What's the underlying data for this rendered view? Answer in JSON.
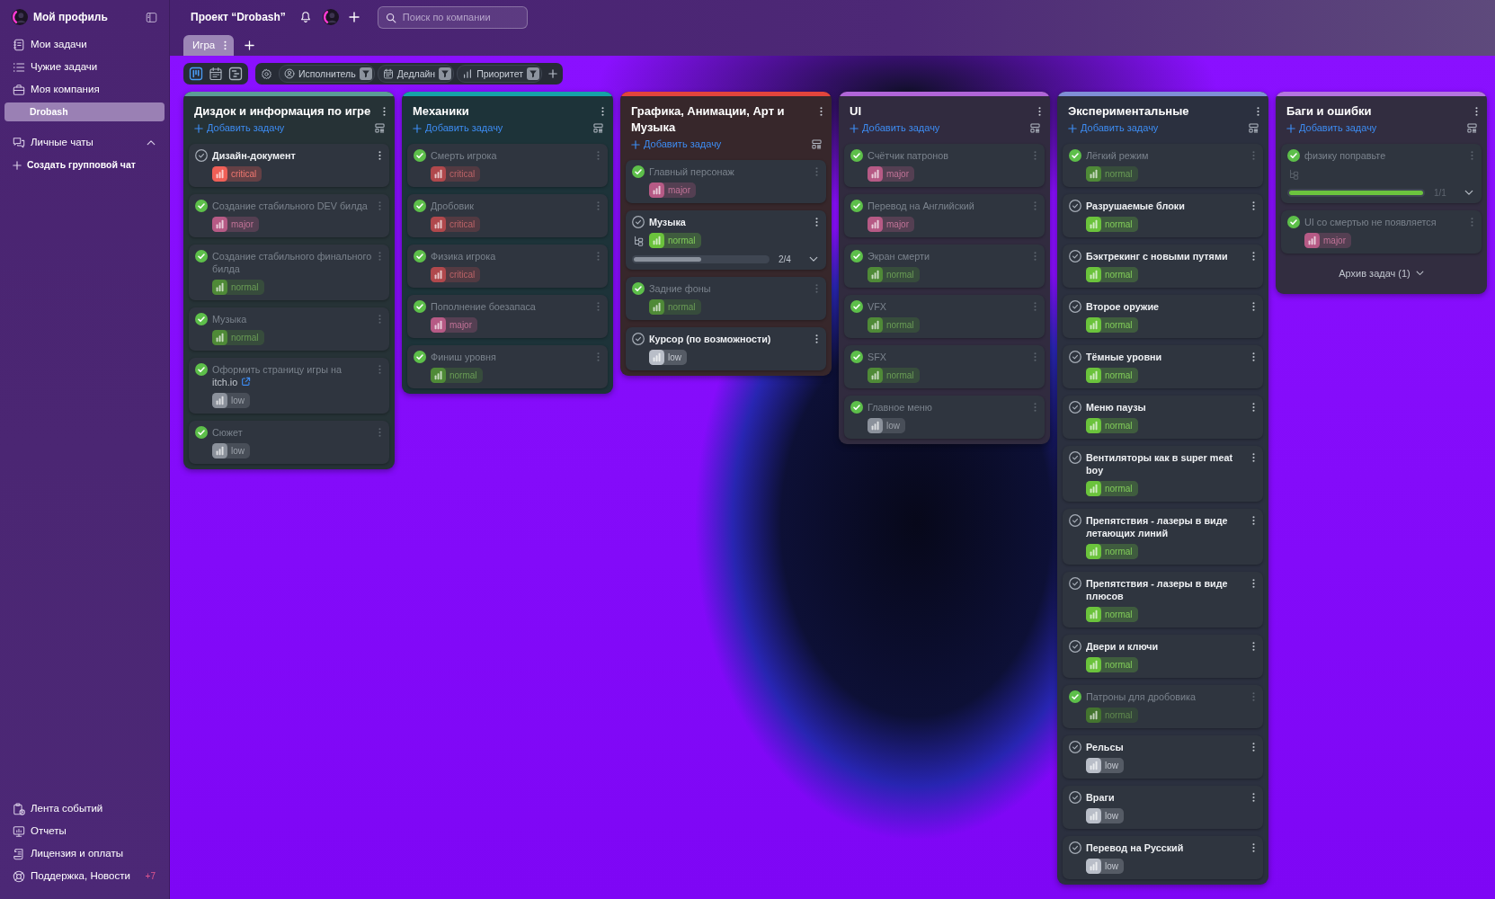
{
  "sidebar": {
    "profile": "Мой профиль",
    "items": [
      {
        "kind": "my-tasks",
        "label": "Мои задачи",
        "selected": false
      },
      {
        "kind": "others-tasks",
        "label": "Чужие задачи",
        "selected": false
      },
      {
        "kind": "company",
        "label": "Моя компания",
        "selected": false
      },
      {
        "kind": "project",
        "label": "Drobash",
        "selected": true
      }
    ],
    "chats": {
      "label": "Личные чаты",
      "expanded": true
    },
    "create_group_chat": "Создать групповой чат",
    "bottom_items": [
      {
        "kind": "feed",
        "label": "Лента событий",
        "selected": false
      },
      {
        "kind": "reports",
        "label": "Отчеты",
        "selected": false
      },
      {
        "kind": "license",
        "label": "Лицензия и оплаты",
        "selected": false
      },
      {
        "kind": "support",
        "label": "Поддержка, Новости",
        "selected": false,
        "count": "+7"
      }
    ]
  },
  "topbar": {
    "project_title": "Проект “Drobash”",
    "search": {
      "placeholder": "Поиск по компании"
    }
  },
  "tabs": [
    {
      "label": "Игра",
      "selected": true
    }
  ],
  "toolbar": {
    "views": [
      {
        "kind": "board",
        "selected": true
      },
      {
        "kind": "calendar",
        "selected": false
      },
      {
        "kind": "gantt",
        "selected": false
      }
    ],
    "filters": [
      {
        "kind": "assignee",
        "label": "Исполнитель"
      },
      {
        "kind": "deadline",
        "label": "Дедлайн"
      },
      {
        "kind": "priority",
        "label": "Приоритет"
      }
    ]
  },
  "columns": [
    {
      "title": "Диздок и информация по игре",
      "color": "#5b9c96",
      "add_task": "Добавить задачу",
      "cards": [
        {
          "title": "Дизайн-документ",
          "done": false,
          "badge": {
            "label": "critical",
            "color": "#ef5f57"
          }
        },
        {
          "title": "Создание стабильного DEV билда",
          "done": true,
          "badge": {
            "label": "major",
            "color": "#b65a85"
          }
        },
        {
          "title": "Создание стабильного финального билда",
          "done": true,
          "badge": {
            "label": "normal",
            "color": "#4f8a37"
          }
        },
        {
          "title": "Музыка",
          "done": true,
          "badge": {
            "label": "normal",
            "color": "#4f8a37"
          }
        },
        {
          "title": "Оформить страницу игры на",
          "link": "itch.io",
          "done": true,
          "badge": {
            "label": "low",
            "color": "#8b919b"
          }
        },
        {
          "title": "Сюжет",
          "done": true,
          "badge": {
            "label": "low",
            "color": "#8b919b"
          }
        }
      ]
    },
    {
      "title": "Механики",
      "color": "#16a2a8",
      "add_task": "Добавить задачу",
      "cards": [
        {
          "title": "Смерть игрока",
          "done": true,
          "badge": {
            "label": "critical",
            "color": "#b0484c"
          }
        },
        {
          "title": "Дробовик",
          "done": true,
          "badge": {
            "label": "critical",
            "color": "#b0484c"
          }
        },
        {
          "title": "Физика игрока",
          "done": true,
          "badge": {
            "label": "critical",
            "color": "#b0484c"
          }
        },
        {
          "title": "Пополнение боезапаса",
          "done": true,
          "badge": {
            "label": "major",
            "color": "#b65a85"
          }
        },
        {
          "title": "Финиш уровня",
          "done": true,
          "badge": {
            "label": "normal",
            "color": "#4f8a37"
          }
        }
      ]
    },
    {
      "title": "Графика, Анимации, Арт и Музыка",
      "color": "#e2453c",
      "add_task": "Добавить задачу",
      "cards": [
        {
          "title": "Главный персонаж",
          "done": true,
          "badge": {
            "label": "major",
            "color": "#b65a85"
          }
        },
        {
          "title": "Музыка",
          "done": false,
          "badge": {
            "label": "normal",
            "color": "#6bc33c"
          },
          "subtasks": {
            "level": 0.5,
            "reading": "2/4"
          }
        },
        {
          "title": "Задние фоны",
          "done": true,
          "badge": {
            "label": "normal",
            "color": "#4f8a37"
          }
        },
        {
          "title": "Курсор (по возможности)",
          "done": false,
          "badge": {
            "label": "low",
            "color": "#b9bec8"
          }
        }
      ]
    },
    {
      "title": "UI",
      "color": "#b065d8",
      "add_task": "Добавить задачу",
      "cards": [
        {
          "title": "Счётчик патронов",
          "done": true,
          "badge": {
            "label": "major",
            "color": "#b65a85"
          }
        },
        {
          "title": "Перевод на Английский",
          "done": true,
          "badge": {
            "label": "major",
            "color": "#b65a85"
          }
        },
        {
          "title": "Экран смерти",
          "done": true,
          "badge": {
            "label": "normal",
            "color": "#4f8a37"
          }
        },
        {
          "title": "VFX",
          "done": true,
          "badge": {
            "label": "normal",
            "color": "#4f8a37"
          }
        },
        {
          "title": "SFX",
          "done": true,
          "badge": {
            "label": "normal",
            "color": "#4f8a37"
          }
        },
        {
          "title": "Главное меню",
          "done": true,
          "badge": {
            "label": "low",
            "color": "#8b919b"
          }
        }
      ]
    },
    {
      "title": "Экспериментальные",
      "color": "#7f8fd6",
      "add_task": "Добавить задачу",
      "cards": [
        {
          "title": "Лёгкий режим",
          "done": true,
          "badge": {
            "label": "normal",
            "color": "#4f8a37"
          }
        },
        {
          "title": "Разрушаемые блоки",
          "done": false,
          "badge": {
            "label": "normal",
            "color": "#6bc33c"
          }
        },
        {
          "title": "Бэктрекинг с новыми путями",
          "done": false,
          "badge": {
            "label": "normal",
            "color": "#6bc33c"
          }
        },
        {
          "title": "Второе оружие",
          "done": false,
          "badge": {
            "label": "normal",
            "color": "#6bc33c"
          }
        },
        {
          "title": "Тёмные уровни",
          "done": false,
          "badge": {
            "label": "normal",
            "color": "#6bc33c"
          }
        },
        {
          "title": "Меню паузы",
          "done": false,
          "badge": {
            "label": "normal",
            "color": "#6bc33c"
          }
        },
        {
          "title": "Вентиляторы как в super meat boy",
          "done": false,
          "badge": {
            "label": "normal",
            "color": "#6bc33c"
          }
        },
        {
          "title": "Препятствия - лазеры в виде летающих линий",
          "done": false,
          "badge": {
            "label": "normal",
            "color": "#6bc33c"
          }
        },
        {
          "title": "Препятствия - лазеры в виде плюсов",
          "done": false,
          "badge": {
            "label": "normal",
            "color": "#6bc33c"
          }
        },
        {
          "title": "Двери и ключи",
          "done": false,
          "badge": {
            "label": "normal",
            "color": "#6bc33c"
          }
        },
        {
          "title": "Патроны для дробовика",
          "done": true,
          "badge": {
            "label": "normal",
            "color": "#44742f"
          }
        },
        {
          "title": "Рельсы",
          "done": false,
          "badge": {
            "label": "low",
            "color": "#b9bec8"
          }
        },
        {
          "title": "Враги",
          "done": false,
          "badge": {
            "label": "low",
            "color": "#b9bec8"
          }
        },
        {
          "title": "Перевод на Русский",
          "done": false,
          "badge": {
            "label": "low",
            "color": "#b9bec8"
          }
        }
      ]
    },
    {
      "title": "Баги и ошибки",
      "color": "#b475df",
      "add_task": "Добавить задачу",
      "cards": [
        {
          "title": "физику поправьте",
          "done": true,
          "subtasks": {
            "level": 1,
            "reading": "1/1"
          }
        },
        {
          "title": "UI со смертью не появляется",
          "done": true,
          "badge": {
            "label": "major",
            "color": "#b65a85"
          }
        }
      ],
      "archive": "Архив задач (1)"
    }
  ]
}
